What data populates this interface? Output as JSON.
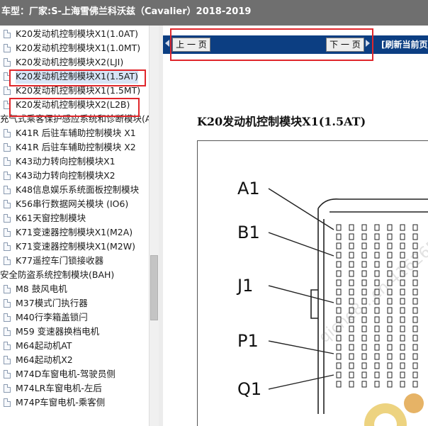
{
  "title": "车型：厂家:S-上海雪佛兰科沃兹（Cavalier）2018-2019",
  "tree": [
    {
      "label": "K20发动机控制模块X1(1.0AT)",
      "kind": "doc"
    },
    {
      "label": "K20发动机控制模块X1(1.0MT)",
      "kind": "doc"
    },
    {
      "label": "K20发动机控制模块X2(LJI)",
      "kind": "doc"
    },
    {
      "label": "K20发动机控制模块X1(1.5AT)",
      "kind": "doc",
      "selected": true
    },
    {
      "label": "K20发动机控制模块X1(1.5MT)",
      "kind": "doc"
    },
    {
      "label": "K20发动机控制模块X2(L2B)",
      "kind": "doc"
    },
    {
      "label": "充气式乘客保护感应系统和诊断模块(A",
      "kind": "folder"
    },
    {
      "label": "K41R 后驻车辅助控制模块 X1",
      "kind": "doc"
    },
    {
      "label": "K41R 后驻车辅助控制模块 X2",
      "kind": "doc"
    },
    {
      "label": "K43动力转向控制模块X1",
      "kind": "doc"
    },
    {
      "label": "K43动力转向控制模块X2",
      "kind": "doc"
    },
    {
      "label": "K48信息娱乐系统面板控制模块",
      "kind": "doc"
    },
    {
      "label": "K56串行数据网关模块 (IO6)",
      "kind": "doc"
    },
    {
      "label": "K61天窗控制模块",
      "kind": "doc"
    },
    {
      "label": "K71变速器控制模块X1(M2A)",
      "kind": "doc"
    },
    {
      "label": "K71变速器控制模块X1(M2W)",
      "kind": "doc"
    },
    {
      "label": "K77遥控车门锁接收器",
      "kind": "doc"
    },
    {
      "label": "安全防盗系统控制模块(BAH)",
      "kind": "folder"
    },
    {
      "label": "M8 鼓风电机",
      "kind": "doc"
    },
    {
      "label": "M37模式门执行器",
      "kind": "doc"
    },
    {
      "label": "M40行李箱盖锁闩",
      "kind": "doc"
    },
    {
      "label": "M59 变速器换档电机",
      "kind": "doc"
    },
    {
      "label": "M64起动机AT",
      "kind": "doc"
    },
    {
      "label": "M64起动机X2",
      "kind": "doc"
    },
    {
      "label": "M74D车窗电机-驾驶员侧",
      "kind": "doc"
    },
    {
      "label": "M74LR车窗电机-左后",
      "kind": "doc"
    },
    {
      "label": "M74P车窗电机-乘客侧",
      "kind": "doc"
    }
  ],
  "nav": {
    "prev_label": "上 一 页",
    "next_label": "下 一 页",
    "refresh_label": "[刷新当前页"
  },
  "document": {
    "heading": "K20发动机控制模块X1(1.5AT)",
    "pin_labels": [
      "A1",
      "B1",
      "J1",
      "P1",
      "Q1"
    ]
  },
  "watermark": "qiche8...cn 416265",
  "colors": {
    "titlebar": "#6f6f6f",
    "navbar": "#0c3e82",
    "highlight": "#e0262b",
    "selection": "#d7e4f5"
  }
}
